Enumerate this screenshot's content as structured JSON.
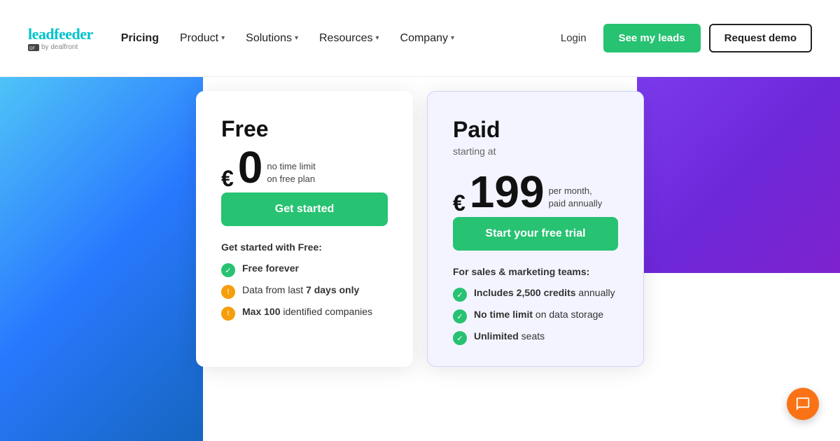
{
  "navbar": {
    "logo": {
      "brand": "leadfeeder",
      "sub_brand": "by dealfront"
    },
    "links": [
      {
        "label": "Pricing",
        "active": true,
        "has_dropdown": false
      },
      {
        "label": "Product",
        "active": false,
        "has_dropdown": true
      },
      {
        "label": "Solutions",
        "active": false,
        "has_dropdown": true
      },
      {
        "label": "Resources",
        "active": false,
        "has_dropdown": true
      },
      {
        "label": "Company",
        "active": false,
        "has_dropdown": true
      }
    ],
    "actions": {
      "login": "Login",
      "see_leads": "See my leads",
      "request_demo": "Request demo"
    }
  },
  "pricing": {
    "free": {
      "title": "Free",
      "price_currency": "€",
      "price_amount": "0",
      "price_note_line1": "no time limit",
      "price_note_line2": "on free plan",
      "cta_label": "Get started",
      "features_title": "Get started with Free:",
      "features": [
        {
          "text": "Free forever",
          "bold": "Free forever",
          "rest": "",
          "icon_type": "green"
        },
        {
          "text": "Data from last 7 days only",
          "bold": "7 days only",
          "before": "Data from last ",
          "after": "",
          "icon_type": "orange"
        },
        {
          "text": "Max 100 identified companies",
          "bold": "Max 100",
          "before": "",
          "after": " identified companies",
          "icon_type": "orange"
        }
      ]
    },
    "paid": {
      "title": "Paid",
      "subtitle": "starting at",
      "price_currency": "€",
      "price_amount": "199",
      "price_note_line1": "per month,",
      "price_note_line2": "paid annually",
      "cta_label": "Start your free trial",
      "features_title": "For sales & marketing teams:",
      "features": [
        {
          "bold": "Includes 2,500 credits",
          "after": " annually",
          "icon_type": "green"
        },
        {
          "before": "No time limit",
          "bold": "No time limit",
          "after": " on data storage",
          "icon_type": "green"
        },
        {
          "bold": "Unlimited",
          "after": " seats",
          "icon_type": "green"
        }
      ]
    }
  }
}
